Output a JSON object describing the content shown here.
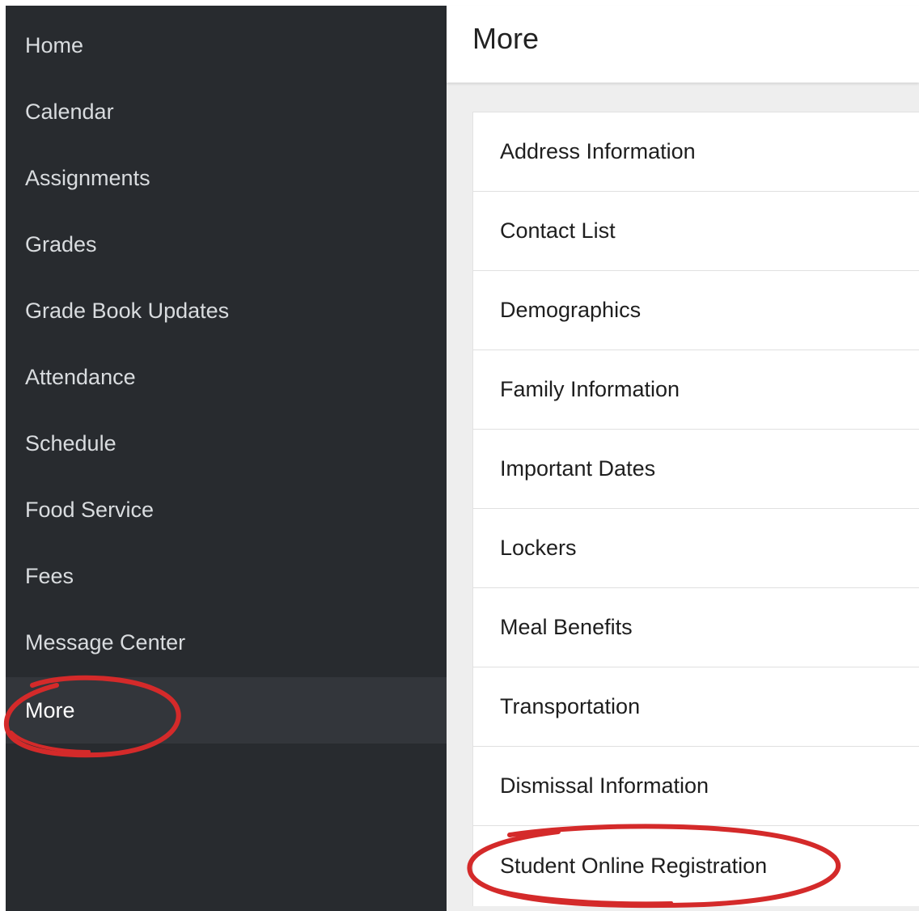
{
  "sidebar": {
    "items": [
      {
        "label": "Home"
      },
      {
        "label": "Calendar"
      },
      {
        "label": "Assignments"
      },
      {
        "label": "Grades"
      },
      {
        "label": "Grade Book Updates"
      },
      {
        "label": "Attendance"
      },
      {
        "label": "Schedule"
      },
      {
        "label": "Food Service"
      },
      {
        "label": "Fees"
      },
      {
        "label": "Message Center"
      },
      {
        "label": "More"
      }
    ],
    "active_item": "More"
  },
  "header": {
    "title": "More"
  },
  "more_list": {
    "items": [
      {
        "label": "Address Information"
      },
      {
        "label": "Contact List"
      },
      {
        "label": "Demographics"
      },
      {
        "label": "Family Information"
      },
      {
        "label": "Important Dates"
      },
      {
        "label": "Lockers"
      },
      {
        "label": "Meal Benefits"
      },
      {
        "label": "Transportation"
      },
      {
        "label": "Dismissal Information"
      },
      {
        "label": "Student Online Registration"
      }
    ]
  },
  "annotations": {
    "color": "#d42a2a",
    "circled_items": [
      "More",
      "Student Online Registration"
    ]
  },
  "colors": {
    "sidebar_bg": "#282b2f",
    "sidebar_active_bg": "#33363b",
    "main_bg": "#eeeeee"
  }
}
